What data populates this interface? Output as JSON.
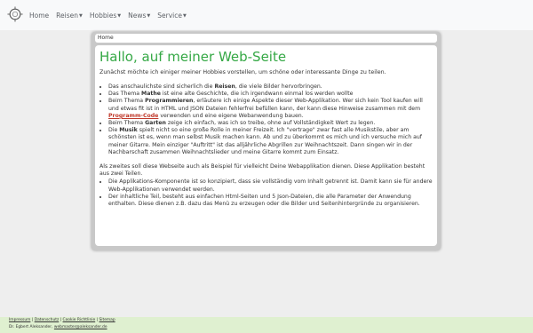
{
  "nav": {
    "logo_icon": "crosshair-target-icon",
    "items": [
      {
        "label": "Home",
        "has_dropdown": false
      },
      {
        "label": "Reisen",
        "has_dropdown": true
      },
      {
        "label": "Hobbies",
        "has_dropdown": true
      },
      {
        "label": "News",
        "has_dropdown": true
      },
      {
        "label": "Service",
        "has_dropdown": true
      }
    ]
  },
  "breadcrumb": "Home",
  "main": {
    "title": "Hallo, auf meiner Web-Seite",
    "intro": "Zunächst möchte ich einiger meiner Hobbies vorstellen, um schöne oder interessante Dinge zu teilen.",
    "list1": [
      {
        "pre": "Das anschaulichste sind sicherlich die ",
        "bold": "Reisen",
        "post": ", die viele Bilder hervorbringen."
      },
      {
        "pre": "Das Thema ",
        "bold": "Mathe",
        "post": " ist eine alte Geschichte, die ich irgendwann einmal los werden wollte"
      },
      {
        "pre": "Beim Thema ",
        "bold": "Programmieren",
        "mid": ", erläutere ich einige Aspekte dieser Web-Applikation. Wer sich kein Tool kaufen will und etwas fit ist in HTML und JSON Dateien fehlerfrei befüllen kann, der kann diese Hinweise zusammen mit dem ",
        "link": "Programm-Code",
        "post": " verwenden und eine eigene Webanwendung bauen."
      },
      {
        "pre": "Beim Thema ",
        "bold": "Garten",
        "post": " zeige ich einfach, was ich so treibe, ohne auf Vollständigkeit Wert zu legen."
      },
      {
        "pre": "Die ",
        "bold": "Musik",
        "post": " spielt nicht so eine große Rolle in meiner Freizeit. Ich \"vertrage\" zwar fast alle Musikstile, aber am schönsten ist es, wenn man selbst Musik machen kann. Ab und zu überkommt es mich und ich versuche mich auf meiner Gitarre. Mein einziger \"Auftritt\" ist das alljährliche Abgrillen zur Weihnachtszeit. Dann singen wir in der Nachbarschaft zusammen Weihnachtslieder und meine Gitarre kommt zum Einsatz."
      }
    ],
    "para2": "Als zweites soll diese Webseite auch als Beispiel für vielleicht Deine Webapplikation dienen. Diese Applikation besteht aus zwei Teilen.",
    "list2": [
      "Die Applikations-Komponente ist so konzipiert, dass sie vollständig vom Inhalt getrennt ist. Damit kann sie für andere Web-Applikationen verwendet werden.",
      "Der inhaltliche Teil, besteht aus einfachen Html-Seiten und 5 Json-Dateien, die alle Parameter der Anwendung enthalten. Diese dienen z.B. dazu das Menü zu erzeugen oder die Bilder und Seitenhintergründe zu organisieren."
    ]
  },
  "footer": {
    "links": [
      "Impressum",
      "Datenschutz",
      "Cookie Richtlinie",
      "Sitemap"
    ],
    "separator": " | ",
    "name": "Dr. Egbert Aleksander,",
    "email": "webmaster@aleksander.de"
  },
  "colors": {
    "title_green": "#35a845",
    "link_red": "#c0392b",
    "footer_bg": "#dff0d0"
  }
}
